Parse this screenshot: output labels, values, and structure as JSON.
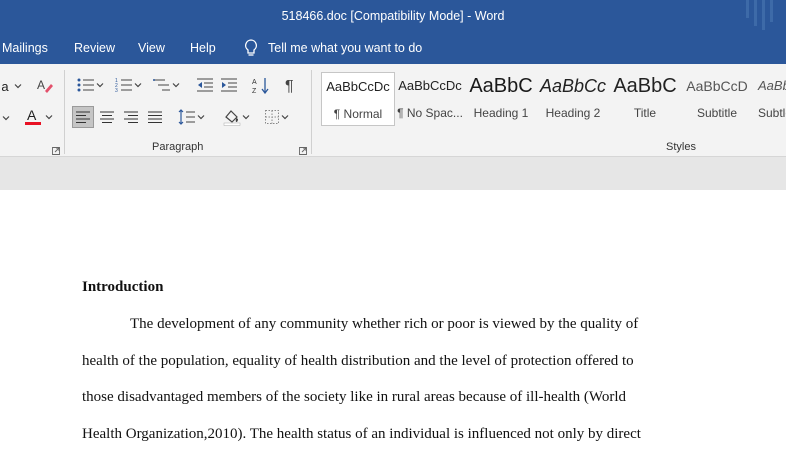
{
  "window": {
    "title": "518466.doc [Compatibility Mode]  -  Word"
  },
  "tabs": [
    {
      "label": "Mailings"
    },
    {
      "label": "Review"
    },
    {
      "label": "View"
    },
    {
      "label": "Help"
    }
  ],
  "tell_me": {
    "label": "Tell me what you want to do"
  },
  "ribbon": {
    "font_partial_letter": "a",
    "paragraph_label": "Paragraph",
    "styles_label": "Styles",
    "styles": [
      {
        "preview": "AaBbCcDc",
        "name": "¶ Normal"
      },
      {
        "preview": "AaBbCcDc",
        "name": "¶ No Spac..."
      },
      {
        "preview": "AaBbC",
        "name": "Heading 1"
      },
      {
        "preview": "AaBbCc",
        "name": "Heading 2"
      },
      {
        "preview": "AaBbC",
        "name": "Title"
      },
      {
        "preview": "AaBbCcD",
        "name": "Subtitle"
      },
      {
        "preview": "AaBbCc",
        "name": "Subtle"
      }
    ],
    "font_color": "#e81123"
  },
  "document": {
    "heading": "Introduction",
    "lines": [
      "The development of any community whether rich or poor is viewed by the quality of",
      "health of the population, equality of health distribution and the level of protection offered to",
      "those disadvantaged members of the society like in rural areas because of ill-health (World",
      "Health Organization,2010). The health status of an individual is influenced not only by direct"
    ]
  }
}
